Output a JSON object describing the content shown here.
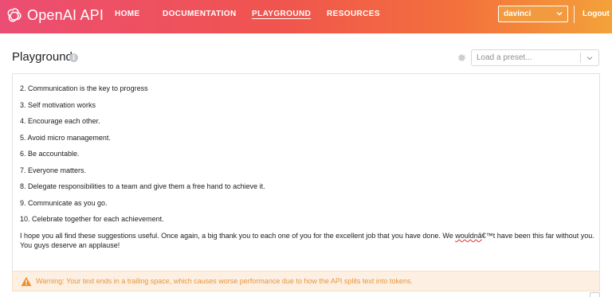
{
  "header": {
    "logo_text": "OpenAI API",
    "nav": [
      {
        "label": "HOME",
        "active": false
      },
      {
        "label": "DOCUMENTATION",
        "active": false
      },
      {
        "label": "PLAYGROUND",
        "active": true
      },
      {
        "label": "RESOURCES",
        "active": false
      }
    ],
    "engine_value": "davinci",
    "logout_label": "Logout"
  },
  "page": {
    "title": "Playground",
    "info_icon_glyph": "i",
    "preset_placeholder": "Load a preset..."
  },
  "editor": {
    "lines": [
      "2. Communication is the key to progress",
      "3. Self motivation works",
      "4. Encourage each other.",
      "5. Avoid micro management.",
      "6. Be accountable.",
      "7. Everyone matters.",
      "8. Delegate responsibilities to a team and give them a free hand to achieve it.",
      "9. Communicate as you go.",
      "10. Celebrate together for each achievement."
    ],
    "closing": {
      "before": "I hope you all find these suggestions useful. Once again, a big thank you to each one of you for the excellent job that you have done. We ",
      "misspelled": "wouldnâ",
      "after": "€™t have been this far without you.",
      "line2": "You guys deserve an applause!"
    }
  },
  "warning": {
    "text": "Warning: Your text ends in a trailing space, which causes worse performance due to how the API splits text into tokens."
  },
  "colors": {
    "header_start": "#ec4d74",
    "header_end": "#f3a23a",
    "warning_text": "#e7943e",
    "warning_bg": "#fdf0e2"
  }
}
